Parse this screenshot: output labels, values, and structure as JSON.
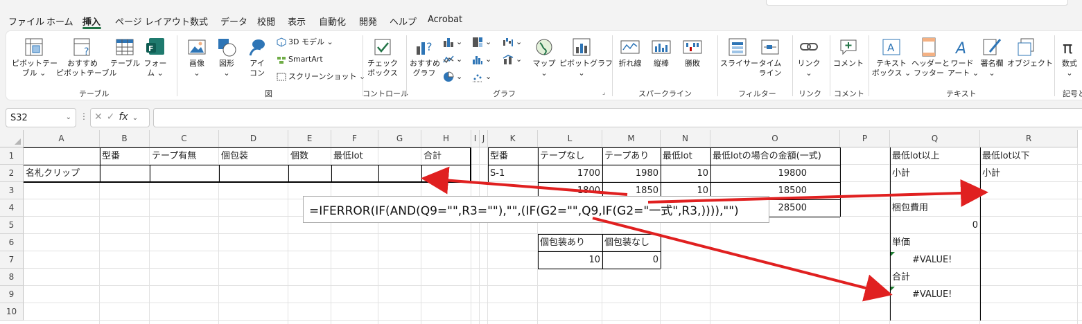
{
  "ribbon_tabs": [
    {
      "label": "ファイル"
    },
    {
      "label": "ホーム"
    },
    {
      "label": "挿入"
    },
    {
      "label": "ページ レイアウト"
    },
    {
      "label": "数式"
    },
    {
      "label": "データ"
    },
    {
      "label": "校閲"
    },
    {
      "label": "表示"
    },
    {
      "label": "自動化"
    },
    {
      "label": "開発"
    },
    {
      "label": "ヘルプ"
    },
    {
      "label": "Acrobat"
    }
  ],
  "active_tab": "挿入",
  "ribbon": {
    "groups": {
      "table": "テーブル",
      "illustrations": "図",
      "controls": "コントロール",
      "charts": "グラフ",
      "sparklines": "スパークライン",
      "filters": "フィルター",
      "links": "リンク",
      "comments": "コメント",
      "text": "テキスト",
      "symbols": "記号と"
    },
    "pivot_table": [
      "ピボットテー",
      "ブル ⌄"
    ],
    "recommended_pivot": [
      "おすすめ",
      "ピボットテーブル"
    ],
    "table": "テーブル",
    "forms": [
      "フォー",
      "ム ⌄"
    ],
    "picture": [
      "画像",
      "⌄"
    ],
    "shapes": [
      "図形",
      "⌄"
    ],
    "icons": [
      "アイ",
      "コン"
    ],
    "models_3d": "3D モデル ⌄",
    "smartart": "SmartArt",
    "screenshot": "スクリーンショット ⌄",
    "checkbox": [
      "チェック",
      "ボックス"
    ],
    "recommended_charts": [
      "おすすめ",
      "グラフ"
    ],
    "maps": [
      "マップ",
      "⌄"
    ],
    "pivot_chart": [
      "ピボットグラフ",
      "⌄"
    ],
    "spark_line": "折れ線",
    "spark_column": "縦棒",
    "spark_winloss": "勝敗",
    "slicer": "スライサー",
    "timeline": [
      "タイム",
      "ライン"
    ],
    "link": [
      "リンク",
      "⌄"
    ],
    "comment": "コメント",
    "textbox": [
      "テキスト",
      "ボックス ⌄"
    ],
    "header_footer": [
      "ヘッダーと",
      "フッター"
    ],
    "wordart": [
      "ワード",
      "アート ⌄"
    ],
    "signature": [
      "署名欄",
      "⌄"
    ],
    "object": "オブジェクト",
    "equation": [
      "数式",
      "⌄"
    ]
  },
  "formula_bar": {
    "name_box": "S32",
    "fx": "fx"
  },
  "columns": [
    "A",
    "B",
    "C",
    "D",
    "E",
    "F",
    "G",
    "H",
    "I",
    "J",
    "K",
    "L",
    "M",
    "N",
    "O",
    "P",
    "Q",
    "R"
  ],
  "rows": [
    "1",
    "2",
    "3",
    "4",
    "5",
    "6",
    "7",
    "8",
    "9",
    "10"
  ],
  "cells": {
    "B1": "型番",
    "C1": "テープ有無",
    "D1": "個包装",
    "E1": "個数",
    "F1": "最低lot",
    "H1": "合計",
    "A2": "名札クリップ",
    "K1": "型番",
    "L1": "テープなし",
    "M1": "テープあり",
    "N1": "最低lot",
    "O1": "最低lotの場合の金額(一式)",
    "K2": "S-1",
    "L2": "1700",
    "M2": "1980",
    "N2": "10",
    "O2": "19800",
    "L3": "1800",
    "M3": "1850",
    "N3": "10",
    "O3": "18500",
    "O4": "28500",
    "L6": "個包装あり",
    "M6": "個包装なし",
    "L7": "10",
    "M7": "0",
    "Q1": "最低lot以上",
    "R1": "最低lot以下",
    "Q2": "小計",
    "R2": "小計",
    "Q4": "梱包費用",
    "Q5": "0",
    "Q6": "単価",
    "Q7": "#VALUE!",
    "Q8": "合計",
    "Q9": "#VALUE!"
  },
  "formula_annotation": "=IFERROR(IF(AND(Q9=\"\",R3=\"\"),\"\",(IF(G2=\"\",Q9,IF(G2=\"一式\",R3,)))),\"\")",
  "colors": {
    "accent": "#217346",
    "arrow": "#e02020",
    "error_indicator": "#1e7d32"
  }
}
